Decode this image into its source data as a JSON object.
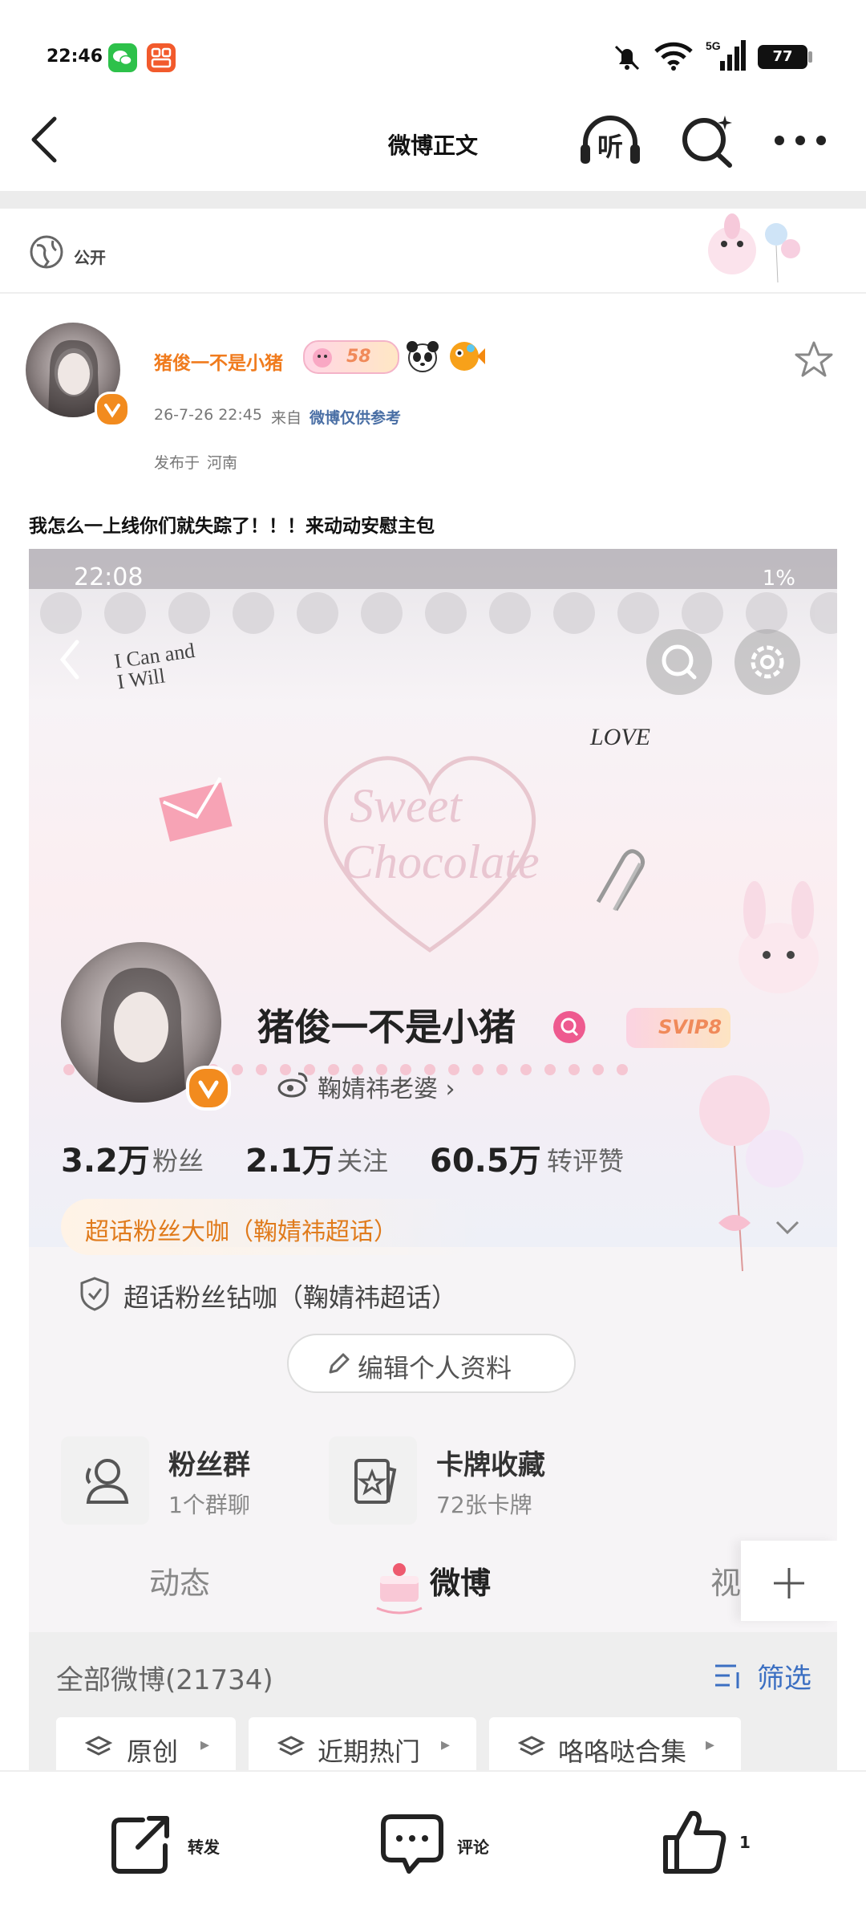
{
  "status_bar": {
    "time": "22:46",
    "battery": "77",
    "network": "5G"
  },
  "nav": {
    "title": "微博正文",
    "listen_label": "听"
  },
  "visibility": {
    "label": "公开"
  },
  "post": {
    "author": "猪俊一不是小猪",
    "level_badge": "58",
    "date": "26-7-26 22:45",
    "source_prefix": "来自",
    "source": "微博仅供参考",
    "location_prefix": "发布于",
    "location": "河南",
    "text": "我怎么一上线你们就失踪了！！！来动动安慰主包"
  },
  "screenshot": {
    "status_time": "22:08",
    "status_right": "1%",
    "decor_text_1": "I Can and I Will",
    "decor_text_2": "LOVE",
    "profile_name": "猪俊一不是小猪",
    "svip_badge": "SVIP8",
    "link_text": "鞠婧祎老婆 ›",
    "stats": [
      {
        "value": "3.2万",
        "label": "粉丝"
      },
      {
        "value": "2.1万",
        "label": "关注"
      },
      {
        "value": "60.5万",
        "label": "转评赞"
      }
    ],
    "badge_primary": "超话粉丝大咖（鞠婧祎超话）",
    "badge_secondary": "超话粉丝钻咖（鞠婧祎超话）",
    "edit_label": "编辑个人资料",
    "cards": [
      {
        "title": "粉丝群",
        "subtitle": "1个群聊"
      },
      {
        "title": "卡牌收藏",
        "subtitle": "72张卡牌"
      }
    ],
    "tabs": [
      "动态",
      "微博",
      "视"
    ],
    "filter_total": "全部微博(21734)",
    "filter_label": "筛选",
    "chips": [
      "原创",
      "近期热门",
      "咯咯哒合集"
    ]
  },
  "actions": {
    "repost": "转发",
    "comment": "评论",
    "like": "1"
  },
  "colors": {
    "accent_orange": "#f07b1d",
    "link_blue": "#4a6fa5",
    "filter_blue": "#3b6fc2"
  }
}
